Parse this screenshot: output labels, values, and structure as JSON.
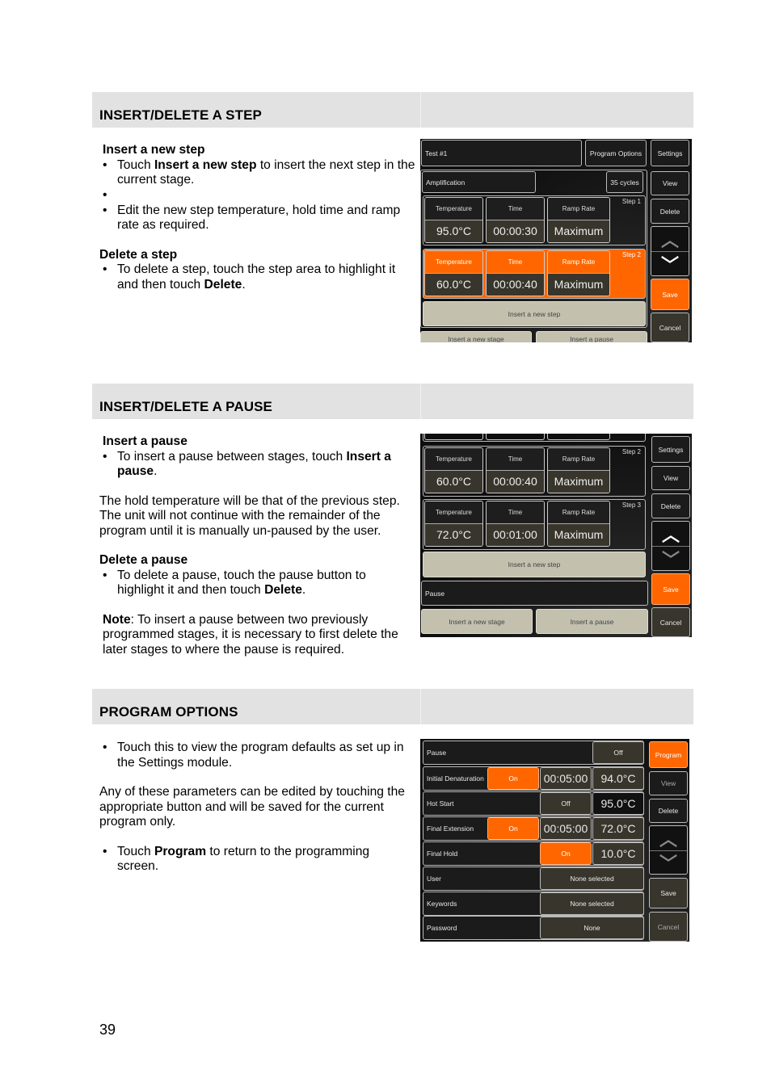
{
  "sections": [
    {
      "title": "INSERT/DELETE A STEP",
      "insert_heading": "Insert a new step",
      "b1": [
        "Touch ",
        "Insert a new step",
        " to insert the next step in the current stage."
      ],
      "b2": "Edit the new step temperature, hold time and ramp rate as required.",
      "delete_heading": "Delete a step",
      "b3": [
        "To delete a step, touch the step area to highlight it and then touch ",
        "Delete",
        "."
      ]
    },
    {
      "title": "INSERT/DELETE A PAUSE",
      "insert_heading": "Insert a pause",
      "b1": [
        "To insert a pause between stages, touch ",
        "Insert a pause",
        "."
      ],
      "para": "The hold temperature will be that of the previous step. The unit will not continue with the remainder of the program until it is manually un-paused by the user.",
      "delete_heading": "Delete a pause",
      "b2": [
        "To delete a pause, touch the pause button to highlight it and then touch ",
        "Delete",
        "."
      ],
      "note": [
        "Note",
        ": To insert a pause between two previously programmed stages, it is necessary to first delete the later stages to where the pause is required."
      ]
    },
    {
      "title": "PROGRAM OPTIONS",
      "b1": "Touch this to view the program defaults as set up in the Settings module.",
      "para": "Any of these parameters can be edited by touching the appropriate button and will be saved for the current program only.",
      "b2": [
        "Touch ",
        "Program",
        " to return to the programming screen."
      ]
    }
  ],
  "screen1": {
    "title": "Test #1",
    "program_options": "Program Options",
    "settings": "Settings",
    "stage": "Amplification",
    "cycles": "35 cycles",
    "labels": {
      "temp": "Temperature",
      "time": "Time",
      "ramp": "Ramp Rate"
    },
    "steps": [
      {
        "name": "Step 1",
        "temp": "95.0°C",
        "time": "00:00:30",
        "ramp": "Maximum"
      },
      {
        "name": "Step 2",
        "temp": "60.0°C",
        "time": "00:00:40",
        "ramp": "Maximum",
        "selected": true
      }
    ],
    "insert_step": "Insert a new step",
    "insert_stage": "Insert a new stage",
    "insert_pause": "Insert a pause",
    "view": "View",
    "delete": "Delete",
    "save": "Save",
    "cancel": "Cancel"
  },
  "screen2": {
    "labels": {
      "temp": "Temperature",
      "time": "Time",
      "ramp": "Ramp Rate"
    },
    "steps": [
      {
        "name": "Step 2",
        "temp": "60.0°C",
        "time": "00:00:40",
        "ramp": "Maximum"
      },
      {
        "name": "Step 3",
        "temp": "72.0°C",
        "time": "00:01:00",
        "ramp": "Maximum"
      }
    ],
    "insert_step": "Insert a new step",
    "pause": "Pause",
    "insert_stage": "Insert a new stage",
    "insert_pause": "Insert a pause",
    "settings": "Settings",
    "view": "View",
    "delete": "Delete",
    "save": "Save",
    "cancel": "Cancel"
  },
  "screen3": {
    "rows": [
      {
        "label": "Pause",
        "state": "Off"
      },
      {
        "label": "Initial Denaturation",
        "state": "On",
        "time": "00:05:00",
        "temp": "94.0°C"
      },
      {
        "label": "Hot Start",
        "state": "Off",
        "temp": "95.0°C"
      },
      {
        "label": "Final Extension",
        "state": "On",
        "time": "00:05:00",
        "temp": "72.0°C"
      },
      {
        "label": "Final Hold",
        "state": "On",
        "temp": "10.0°C"
      },
      {
        "label": "User",
        "value": "None selected"
      },
      {
        "label": "Keywords",
        "value": "None selected"
      },
      {
        "label": "Password",
        "value": "None"
      }
    ],
    "program": "Program",
    "view": "View",
    "delete": "Delete",
    "save": "Save",
    "cancel": "Cancel"
  },
  "accent": "#ff6600",
  "page_number": "39"
}
